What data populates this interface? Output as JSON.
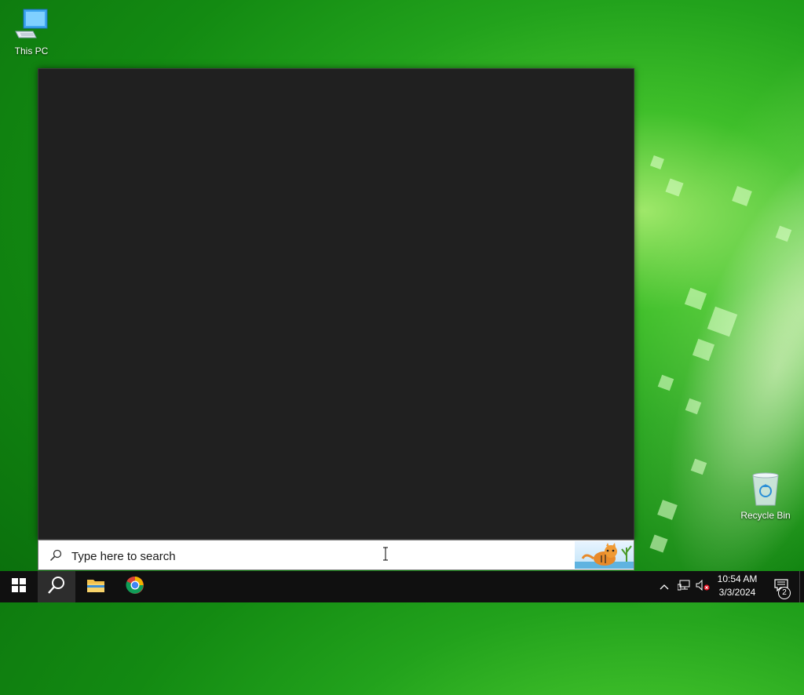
{
  "desktop": {
    "icons": [
      {
        "label": "This PC",
        "icon": "computer-icon"
      },
      {
        "label": "Recycle Bin",
        "icon": "recycle-bin-icon"
      }
    ]
  },
  "search": {
    "placeholder": "Type here to search",
    "doodle": "tiger-doodle-image"
  },
  "taskbar": {
    "start": "windows-logo-icon",
    "search": "search-icon",
    "apps": [
      {
        "name": "File Explorer",
        "icon": "folder-icon"
      },
      {
        "name": "Google Chrome",
        "icon": "chrome-icon"
      }
    ],
    "tray": {
      "icons": [
        "chevron-up-icon",
        "network-icon",
        "volume-muted-icon"
      ],
      "time": "10:54 AM",
      "date": "3/3/2024",
      "notifications": "2"
    }
  },
  "colors": {
    "panel_bg": "#202020",
    "taskbar_bg": "#101010",
    "wallpaper_green": "#1e9a1a"
  }
}
